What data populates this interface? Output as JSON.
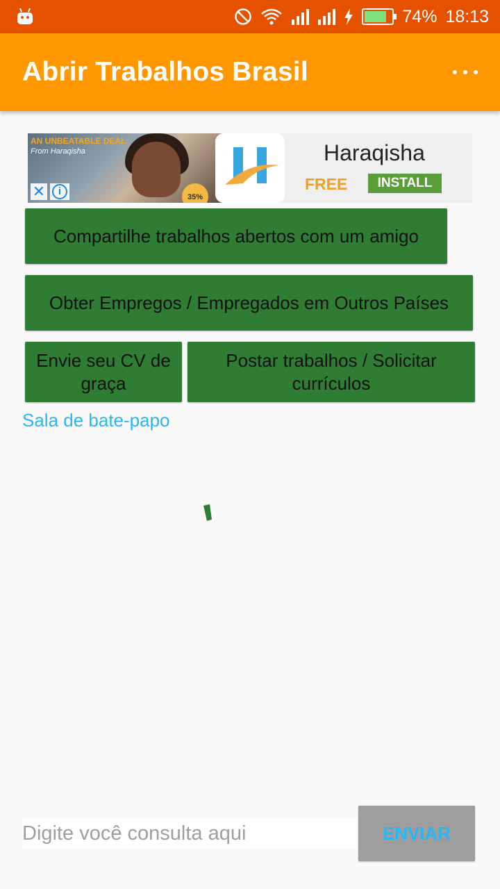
{
  "status_bar": {
    "battery": "74%",
    "time": "18:13",
    "battery_level": 0.74
  },
  "app_bar": {
    "title": "Abrir Trabalhos Brasil",
    "overflow_icon": "more-vert-icon"
  },
  "ad": {
    "tagline": "AN UNBEATABLE DEAL",
    "from": "From Haraqisha",
    "discount": "35%",
    "app_name": "Haraqisha",
    "price": "FREE",
    "install_label": "INSTALL"
  },
  "buttons": {
    "share": "Compartilhe trabalhos abertos com um amigo",
    "abroad": "Obter Empregos / Empregados em Outros Países",
    "cv": "Envie seu CV de graça",
    "post": "Postar trabalhos / Solicitar currículos"
  },
  "chat_link": "Sala de bate-papo",
  "input": {
    "placeholder": "Digite você consulta aqui",
    "value": ""
  },
  "send_label": "ENVIAR",
  "colors": {
    "status_bar": "#e65100",
    "app_bar": "#ff9800",
    "button_green": "#2e7d32",
    "link_blue": "#29b6f6",
    "send_bg": "#9e9e9e"
  }
}
